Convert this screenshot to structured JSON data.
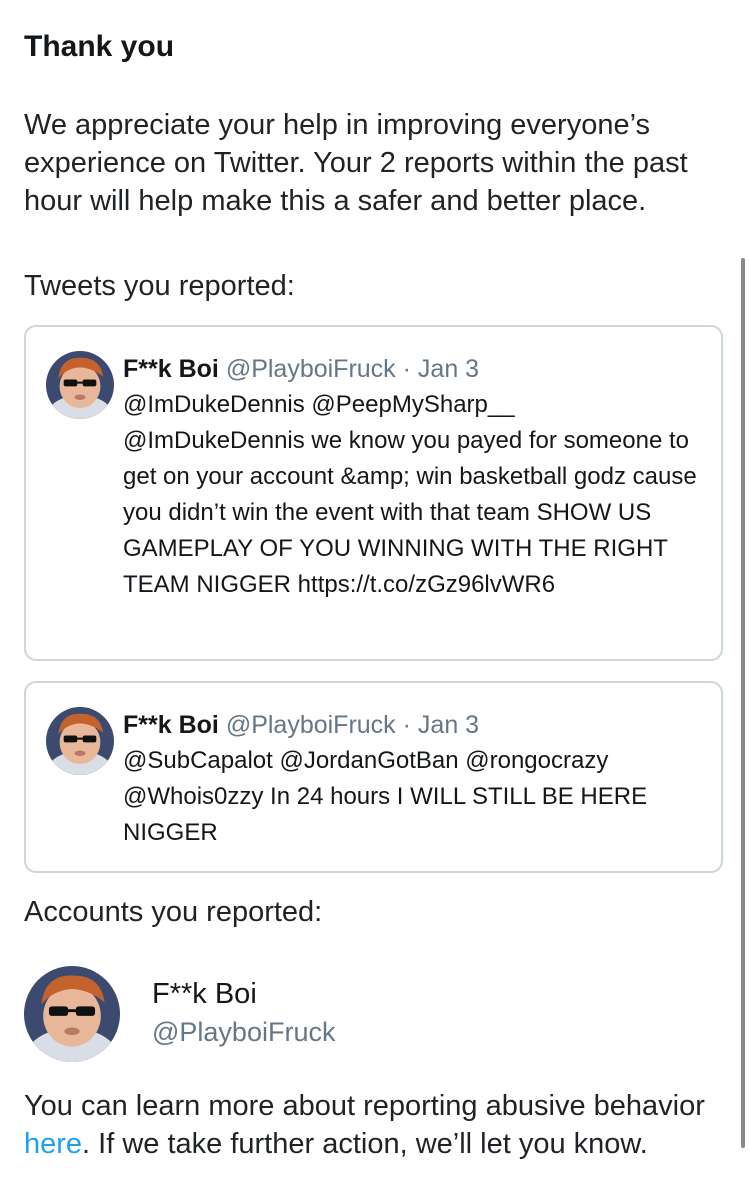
{
  "heading": "Thank you",
  "intro": "We appreciate your help in improving everyone’s experience on Twitter. Your 2 reports within the past hour will help make this a safer and better place.",
  "tweets_label": "Tweets you reported:",
  "tweets": [
    {
      "name": "F**k Boi",
      "handle": "@PlayboiFruck",
      "separator": "·",
      "date": "Jan 3",
      "text": "@ImDukeDennis @PeepMySharp__ @ImDukeDennis we know you payed for someone to get on your account &amp; win basketball godz cause you didn’t win the event with that team SHOW US GAMEPLAY OF YOU WINNING WITH THE RIGHT TEAM NIGGER https://t.co/zGz96lvWR6"
    },
    {
      "name": "F**k Boi",
      "handle": "@PlayboiFruck",
      "separator": "·",
      "date": "Jan 3",
      "text": "@SubCapalot @JordanGotBan @rongocrazy @Whois0zzy In 24 hours I WILL STILL BE HERE NIGGER"
    }
  ],
  "accounts_label": "Accounts you reported:",
  "account": {
    "name": "F**k Boi",
    "handle": "@PlayboiFruck"
  },
  "outro": {
    "before": "You can learn more about reporting abusive behavior ",
    "link": "here",
    "after": ". If we take further action, we’ll let you know."
  },
  "colors": {
    "link": "#1da1f2",
    "muted": "#657786",
    "border": "#ccd6dd"
  },
  "icons": {
    "avatar": "profile-photo"
  }
}
